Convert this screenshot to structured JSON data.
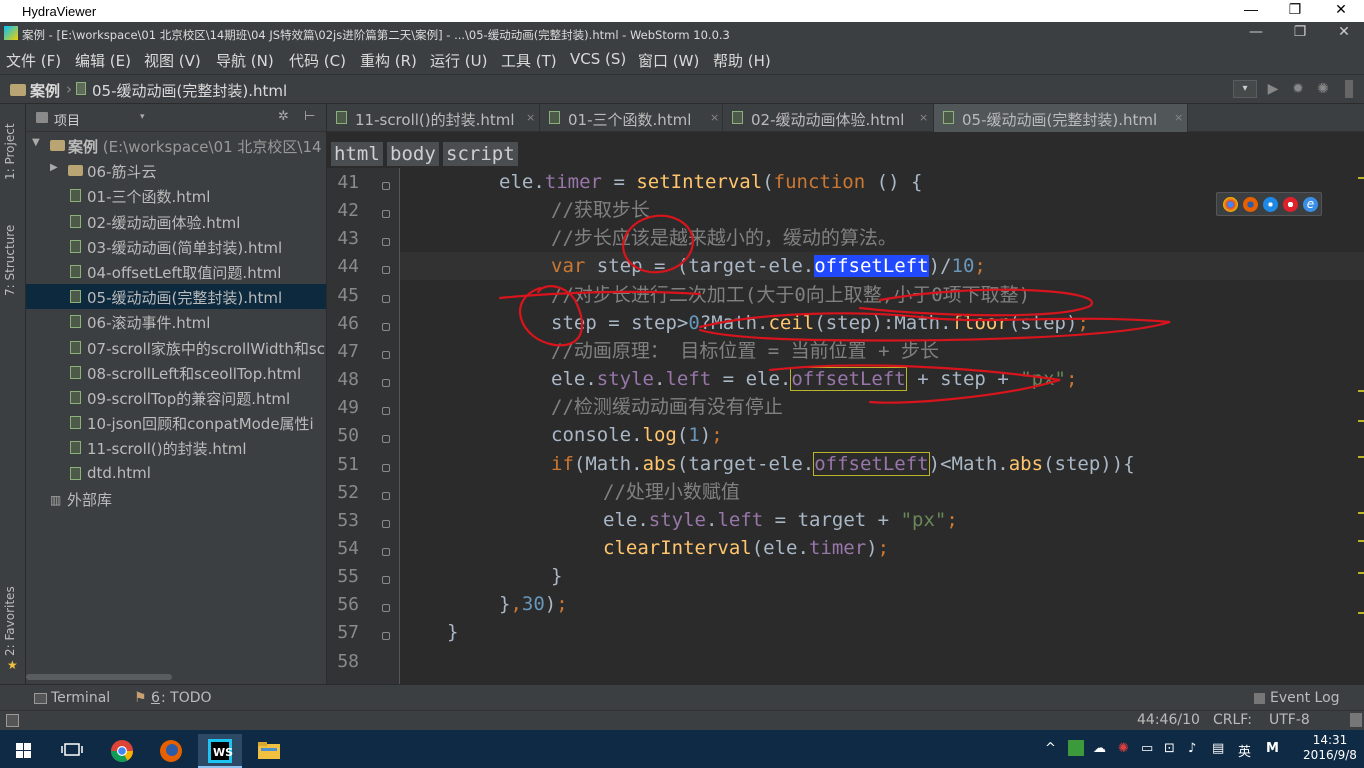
{
  "viewer": {
    "title": "HydraViewer",
    "minimize_glyph": "—",
    "restore_glyph": "❐",
    "close_glyph": "✕"
  },
  "window": {
    "title": "案例 - [E:\\workspace\\01 北京校区\\14期班\\04 JS特效篇\\02js进阶篇第二天\\案例] - ...\\05-缓动动画(完整封装).html - WebStorm 10.0.3",
    "minimize_glyph": "—",
    "restore_glyph": "❐",
    "close_glyph": "✕"
  },
  "menu": [
    "文件 (F)",
    "编辑 (E)",
    "视图 (V)",
    "导航 (N)",
    "代码 (C)",
    "重构 (R)",
    "运行 (U)",
    "工具 (T)",
    "VCS (S)",
    "窗口 (W)",
    "帮助 (H)"
  ],
  "navbar": {
    "project": "案例",
    "separator": "›",
    "file": "05-缓动动画(完整封装).html",
    "run_combo_glyph": "▾",
    "icons": [
      "run-icon",
      "debug-icon",
      "coverage-icon"
    ]
  },
  "tool_windows": {
    "left": [
      "1: Project",
      "7: Structure",
      "2: Favorites"
    ]
  },
  "project_panel": {
    "title": "项目",
    "tree": [
      {
        "type": "root",
        "label": "案例",
        "path": " (E:\\workspace\\01 北京校区\\14"
      },
      {
        "type": "folder",
        "label": "06-筋斗云"
      },
      {
        "type": "file",
        "label": "01-三个函数.html"
      },
      {
        "type": "file",
        "label": "02-缓动动画体验.html"
      },
      {
        "type": "file",
        "label": "03-缓动动画(简单封装).html"
      },
      {
        "type": "file",
        "label": "04-offsetLeft取值问题.html"
      },
      {
        "type": "file",
        "label": "05-缓动动画(完整封装).html",
        "selected": true
      },
      {
        "type": "file",
        "label": "06-滚动事件.html"
      },
      {
        "type": "file",
        "label": "07-scroll家族中的scrollWidth和sc"
      },
      {
        "type": "file",
        "label": "08-scrollLeft和sceollTop.html"
      },
      {
        "type": "file",
        "label": "09-scrollTop的兼容问题.html"
      },
      {
        "type": "file",
        "label": "10-json回顾和conpatMode属性i"
      },
      {
        "type": "file",
        "label": "11-scroll()的封装.html"
      },
      {
        "type": "file",
        "label": "dtd.html"
      },
      {
        "type": "lib",
        "label": "外部库"
      }
    ]
  },
  "tabs": [
    {
      "label": "11-scroll()的封装.html",
      "active": false
    },
    {
      "label": "01-三个函数.html",
      "active": false
    },
    {
      "label": "02-缓动动画体验.html",
      "active": false
    },
    {
      "label": "05-缓动动画(完整封装).html",
      "active": true
    }
  ],
  "tab_close_glyph": "×",
  "breadcrumbs": [
    "html",
    "body",
    "script"
  ],
  "editor": {
    "current_line": 44,
    "lines": [
      {
        "n": 41,
        "indent": 2,
        "code": "ele.timer = setInterval(function () {"
      },
      {
        "n": 42,
        "indent": 3,
        "code": "//获取步长"
      },
      {
        "n": 43,
        "indent": 3,
        "code": "//步长应该是越来越小的，缓动的算法。"
      },
      {
        "n": 44,
        "indent": 3,
        "code": "var step = (target-ele.offsetLeft)/10;"
      },
      {
        "n": 45,
        "indent": 3,
        "code": "//对步长进行二次加工(大于0向上取整,小于0项下取整)"
      },
      {
        "n": 46,
        "indent": 3,
        "code": "step = step>0?Math.ceil(step):Math.floor(step);"
      },
      {
        "n": 47,
        "indent": 3,
        "code": "//动画原理： 目标位置 = 当前位置 + 步长"
      },
      {
        "n": 48,
        "indent": 3,
        "code": "ele.style.left = ele.offsetLeft + step + \"px\";"
      },
      {
        "n": 49,
        "indent": 3,
        "code": "//检测缓动动画有没有停止"
      },
      {
        "n": 50,
        "indent": 3,
        "code": "console.log(1);"
      },
      {
        "n": 51,
        "indent": 3,
        "code": "if(Math.abs(target-ele.offsetLeft)<Math.abs(step)){"
      },
      {
        "n": 52,
        "indent": 4,
        "code": "//处理小数赋值"
      },
      {
        "n": 53,
        "indent": 4,
        "code": "ele.style.left = target + \"px\";"
      },
      {
        "n": 54,
        "indent": 4,
        "code": "clearInterval(ele.timer);"
      },
      {
        "n": 55,
        "indent": 3,
        "code": "}"
      },
      {
        "n": 56,
        "indent": 2,
        "code": "},30);"
      },
      {
        "n": 57,
        "indent": 1,
        "code": "}"
      },
      {
        "n": 58,
        "indent": 0,
        "code": ""
      }
    ]
  },
  "bottom_tools": {
    "terminal": "Terminal",
    "todo_prefix": "6",
    "todo_suffix": ": TODO",
    "event_log": "Event Log"
  },
  "status": {
    "position": "44:46/10",
    "line_sep": "CRLF:",
    "encoding": "UTF-8"
  },
  "taskbar": {
    "apps": [
      "windows-start",
      "task-view",
      "chrome",
      "firefox",
      "webstorm",
      "file-explorer"
    ],
    "ime": "英",
    "ime2": "M",
    "time": "14:31",
    "date": "2016/9/8",
    "tray_up": "^"
  }
}
